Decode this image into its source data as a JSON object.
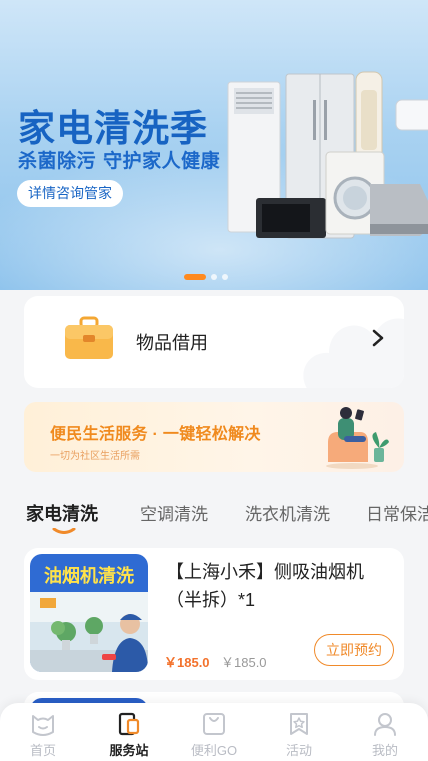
{
  "banner": {
    "title": "家电清洗季",
    "subtitle": "杀菌除污 守护家人健康",
    "cta_label": "详情咨询管家",
    "slides": 4,
    "active_slide": 1
  },
  "borrow": {
    "label": "物品借用",
    "icon": "toolbox-icon"
  },
  "promo": {
    "title": "便民生活服务 · 一键轻松解决",
    "subtitle": "一切为社区生活所需"
  },
  "tabs": [
    {
      "label": "家电清洗",
      "active": true
    },
    {
      "label": "空调清洗",
      "active": false
    },
    {
      "label": "洗衣机清洗",
      "active": false
    },
    {
      "label": "日常保洁",
      "active": false
    }
  ],
  "services": [
    {
      "thumb_title": "油烟机清洗",
      "name": "【上海小禾】侧吸油烟机（半拆）*1",
      "price": "￥185.0",
      "original_price": "￥185.0",
      "button_label": "立即预约"
    }
  ],
  "bottom_nav": [
    {
      "label": "首页",
      "icon": "home-icon",
      "active": false
    },
    {
      "label": "服务站",
      "icon": "service-station-icon",
      "active": true
    },
    {
      "label": "便利GO",
      "icon": "shopping-bag-icon",
      "active": false
    },
    {
      "label": "活动",
      "icon": "activity-star-icon",
      "active": false
    },
    {
      "label": "我的",
      "icon": "user-icon",
      "active": false
    }
  ],
  "colors": {
    "accent": "#f08a2a",
    "banner_blue": "#1763c2",
    "promo_orange": "#f08a1e"
  }
}
